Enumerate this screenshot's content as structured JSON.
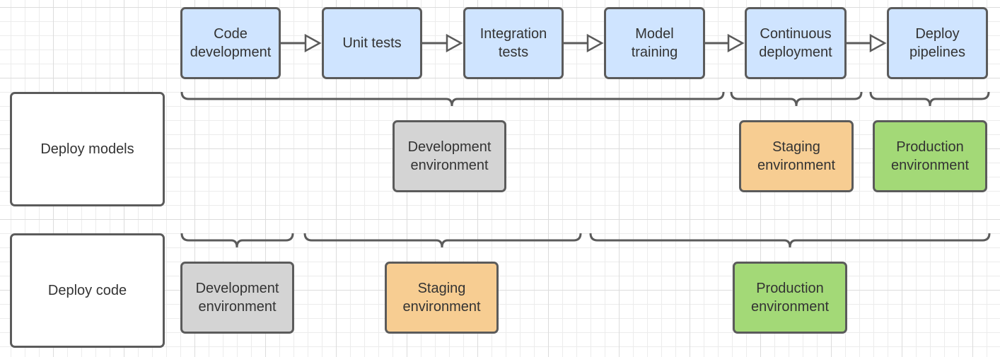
{
  "colors": {
    "pipeline": "#cfe4ff",
    "lane": "#ffffff",
    "development": "#d4d4d4",
    "staging": "#f7cd92",
    "production": "#a3d977",
    "stroke": "#5b5b5b",
    "text": "#333333"
  },
  "pipeline": [
    {
      "id": "code-development",
      "label": "Code\ndevelopment"
    },
    {
      "id": "unit-tests",
      "label": "Unit tests"
    },
    {
      "id": "integration-tests",
      "label": "Integration\ntests"
    },
    {
      "id": "model-training",
      "label": "Model\ntraining"
    },
    {
      "id": "continuous-deployment",
      "label": "Continuous\ndeployment"
    },
    {
      "id": "deploy-pipelines",
      "label": "Deploy\npipelines"
    }
  ],
  "lanes": {
    "deploy_models": {
      "label": "Deploy models",
      "environments": [
        {
          "id": "models-development-env",
          "label": "Development\nenvironment",
          "type": "development",
          "covers": [
            "code-development",
            "unit-tests",
            "integration-tests",
            "model-training"
          ]
        },
        {
          "id": "models-staging-env",
          "label": "Staging\nenvironment",
          "type": "staging",
          "covers": [
            "continuous-deployment"
          ]
        },
        {
          "id": "models-production-env",
          "label": "Production\nenvironment",
          "type": "production",
          "covers": [
            "deploy-pipelines"
          ]
        }
      ]
    },
    "deploy_code": {
      "label": "Deploy code",
      "environments": [
        {
          "id": "code-development-env",
          "label": "Development\nenvironment",
          "type": "development",
          "covers": [
            "code-development"
          ]
        },
        {
          "id": "code-staging-env",
          "label": "Staging\nenvironment",
          "type": "staging",
          "covers": [
            "unit-tests",
            "integration-tests"
          ]
        },
        {
          "id": "code-production-env",
          "label": "Production\nenvironment",
          "type": "production",
          "covers": [
            "model-training",
            "continuous-deployment",
            "deploy-pipelines"
          ]
        }
      ]
    }
  }
}
